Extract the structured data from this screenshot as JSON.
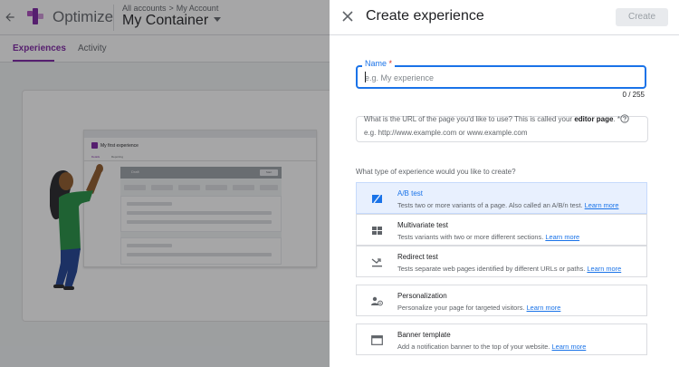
{
  "app": {
    "name": "Optimize",
    "breadcrumb": {
      "all_accounts": "All accounts",
      "separator": ">",
      "account": "My Account"
    },
    "container": "My Container",
    "tabs": [
      {
        "label": "Experiences",
        "active": true
      },
      {
        "label": "Activity",
        "active": false
      }
    ],
    "illustration": {
      "title": "My first experience",
      "tab1": "Details",
      "tab2": "Reporting",
      "panel_title": "Draft",
      "panel_button": "Start"
    },
    "brand_color": "#7b1fa2"
  },
  "dialog": {
    "title": "Create experience",
    "create_label": "Create",
    "name": {
      "label": "Name",
      "required_mark": "*",
      "placeholder": "e.g. My experience",
      "value": "",
      "counter": "0 / 255"
    },
    "url": {
      "label_prefix": "What is the URL of the page you'd like to use? This is called your ",
      "label_bold": "editor page",
      "label_suffix": ". *",
      "placeholder": "e.g. http://www.example.com or www.example.com",
      "help_icon": "help-circle-icon"
    },
    "type_question": "What type of experience would you like to create?",
    "options": [
      {
        "title": "A/B test",
        "desc": "Tests two or more variants of a page. Also called an A/B/n test.",
        "link": "Learn more",
        "icon": "ab-test-icon",
        "selected": true
      },
      {
        "title": "Multivariate test",
        "desc": "Tests variants with two or more different sections.",
        "link": "Learn more",
        "icon": "multivariate-icon",
        "selected": false
      },
      {
        "title": "Redirect test",
        "desc": "Tests separate web pages identified by different URLs or paths.",
        "link": "Learn more",
        "icon": "redirect-icon",
        "selected": false
      },
      {
        "title": "Personalization",
        "desc": "Personalize your page for targeted visitors.",
        "link": "Learn more",
        "icon": "personalization-icon",
        "selected": false
      },
      {
        "title": "Banner template",
        "desc": "Add a notification banner to the top of your website.",
        "link": "Learn more",
        "icon": "banner-icon",
        "selected": false
      }
    ],
    "accent_color": "#1a73e8"
  }
}
